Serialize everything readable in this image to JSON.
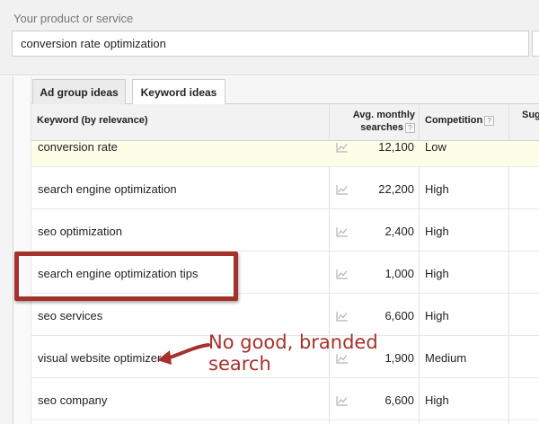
{
  "product": {
    "label": "Your product or service",
    "value": "conversion rate optimization"
  },
  "tabs": [
    {
      "label": "Ad group ideas",
      "active": false
    },
    {
      "label": "Keyword ideas",
      "active": true
    }
  ],
  "table": {
    "headers": {
      "keyword": "Keyword (by relevance)",
      "avg_line1": "Avg. monthly",
      "avg_line2": "searches",
      "competition": "Competition",
      "suggested": "Sug",
      "help_glyph": "?"
    },
    "rows": [
      {
        "keyword": "conversion rate",
        "searches": "12,100",
        "competition": "Low"
      },
      {
        "keyword": "search engine optimization",
        "searches": "22,200",
        "competition": "High"
      },
      {
        "keyword": "seo optimization",
        "searches": "2,400",
        "competition": "High"
      },
      {
        "keyword": "search engine optimization tips",
        "searches": "1,000",
        "competition": "High"
      },
      {
        "keyword": "seo services",
        "searches": "6,600",
        "competition": "High"
      },
      {
        "keyword": "visual website optimizer",
        "searches": "1,900",
        "competition": "Medium"
      },
      {
        "keyword": "seo company",
        "searches": "6,600",
        "competition": "High"
      }
    ],
    "trend_icon": "trend-chart-icon"
  },
  "annotation": {
    "line1": "No good, branded",
    "line2": "search",
    "color": "#a6302c"
  }
}
